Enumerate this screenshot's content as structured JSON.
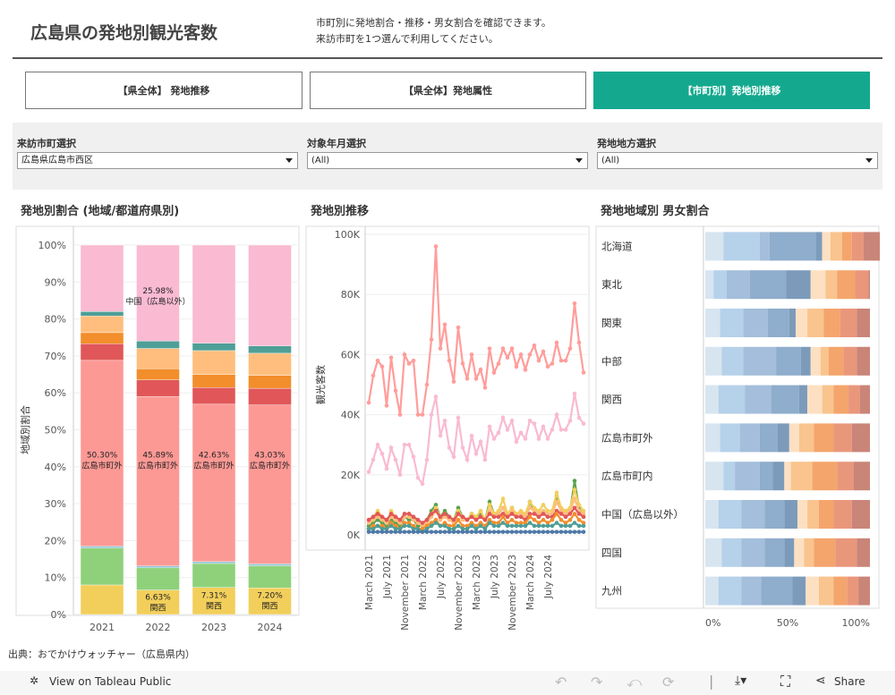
{
  "header": {
    "title": "広島県の発地別観光客数",
    "desc_line1": "市町別に発地割合・推移・男女割合を確認できます。",
    "desc_line2": "来訪市町を1つ選んで利用してください。"
  },
  "tabs": [
    {
      "label": "【県全体】 発地推移"
    },
    {
      "label": "【県全体】発地属性"
    },
    {
      "label": "【市町別】発地別推移"
    }
  ],
  "filters": {
    "city": {
      "label": "来訪市町選択",
      "value": "広島県広島市西区"
    },
    "month": {
      "label": "対象年月選択",
      "value": "(All)"
    },
    "region": {
      "label": "発地地方選択",
      "value": "(All)"
    }
  },
  "sections": {
    "share": "発地別割合 (地域/都道府県別)",
    "trend": "発地別推移",
    "gender": "発地地域別 男女割合"
  },
  "colors": {
    "accent": "#14a98f"
  },
  "chart_data": [
    {
      "type": "bar",
      "stacked": true,
      "normalized": true,
      "ylabel": "地域別割合",
      "categories": [
        "2021",
        "2022",
        "2023",
        "2024"
      ],
      "yticks": [
        "0%",
        "10%",
        "20%",
        "30%",
        "40%",
        "50%",
        "60%",
        "70%",
        "80%",
        "90%",
        "100%"
      ],
      "segment_colors": [
        "#f2cf5b",
        "#8fd17a",
        "#8cc3d4",
        "#fd9995",
        "#e15759",
        "#f28e2b",
        "#ffbe7d",
        "#4e9f97",
        "#f9bad2"
      ],
      "series_values": [
        [
          0.08,
          0.1,
          0.005,
          0.503,
          0.045,
          0.03,
          0.045,
          0.012,
          0.18
        ],
        [
          0.0663,
          0.06,
          0.005,
          0.4589,
          0.045,
          0.03,
          0.055,
          0.02,
          0.2598
        ],
        [
          0.0731,
          0.065,
          0.005,
          0.4263,
          0.045,
          0.035,
          0.065,
          0.02,
          0.2656
        ],
        [
          0.072,
          0.06,
          0.005,
          0.4303,
          0.045,
          0.035,
          0.06,
          0.02,
          0.2727
        ]
      ],
      "labels": [
        {
          "bar": 0,
          "text": "50.30%",
          "sub": "広島市町外",
          "at": 0.42
        },
        {
          "bar": 1,
          "text": "45.89%",
          "sub": "広島市町外",
          "at": 0.42
        },
        {
          "bar": 2,
          "text": "42.63%",
          "sub": "広島市町外",
          "at": 0.42
        },
        {
          "bar": 3,
          "text": "43.03%",
          "sub": "広島市町外",
          "at": 0.42
        },
        {
          "bar": 1,
          "text": "25.98%",
          "sub": "中国（広島以外）",
          "at": 0.865
        },
        {
          "bar": 1,
          "text": "6.63%",
          "sub": "関西",
          "at": 0.035
        },
        {
          "bar": 2,
          "text": "7.31%",
          "sub": "関西",
          "at": 0.04
        },
        {
          "bar": 3,
          "text": "7.20%",
          "sub": "関西",
          "at": 0.04
        }
      ]
    },
    {
      "type": "line",
      "ylabel": "観光客数",
      "ylim": [
        0,
        100000
      ],
      "yticks": [
        "0K",
        "20K",
        "40K",
        "60K",
        "80K",
        "100K"
      ],
      "xticks": [
        "March 2021",
        "July 2021",
        "November 2021",
        "March 2022",
        "July 2022",
        "November 2022",
        "March 2023",
        "July 2023",
        "November 2023",
        "March 2024",
        "July 2024"
      ],
      "series": [
        {
          "color": "#ff9d9a",
          "values": [
            44000,
            53000,
            58000,
            56000,
            43000,
            59000,
            48000,
            40000,
            60000,
            57000,
            58000,
            40000,
            40000,
            50000,
            65000,
            96000,
            62000,
            70000,
            58000,
            51000,
            69000,
            57000,
            52000,
            60000,
            52000,
            55000,
            49000,
            62000,
            54000,
            57000,
            62000,
            59000,
            62000,
            56000,
            60000,
            55000,
            60000,
            63000,
            58000,
            61000,
            56000,
            57000,
            64000,
            58000,
            58000,
            62000,
            77000,
            64000,
            54000
          ]
        },
        {
          "color": "#f9bad2",
          "values": [
            21000,
            25000,
            30000,
            27000,
            22000,
            29000,
            25000,
            20000,
            30000,
            30000,
            26000,
            19000,
            17000,
            25000,
            40000,
            46000,
            33000,
            38000,
            29000,
            26000,
            39000,
            29000,
            25000,
            33000,
            27000,
            31000,
            25000,
            36000,
            32000,
            34000,
            39000,
            35000,
            38000,
            31000,
            34000,
            32000,
            38000,
            37000,
            32000,
            36000,
            32000,
            35000,
            40000,
            35000,
            35000,
            38000,
            47000,
            39000,
            37000
          ]
        },
        {
          "color": "#59a14f",
          "values": [
            3000,
            4000,
            5000,
            4000,
            3000,
            5000,
            4000,
            3000,
            6000,
            5000,
            5000,
            3000,
            3000,
            5000,
            8000,
            10000,
            6000,
            8000,
            6000,
            5000,
            9000,
            6000,
            5000,
            7000,
            6000,
            7000,
            5000,
            11000,
            7000,
            7000,
            9000,
            6000,
            9000,
            6000,
            7000,
            6000,
            11000,
            8000,
            6000,
            8000,
            7000,
            7000,
            13000,
            8000,
            7000,
            8000,
            18000,
            9000,
            6000
          ]
        },
        {
          "color": "#f2cf5b",
          "values": [
            5000,
            6000,
            8000,
            6000,
            4000,
            8000,
            6000,
            4000,
            7000,
            7000,
            6000,
            4000,
            3000,
            5000,
            7000,
            9000,
            6000,
            7000,
            6000,
            5000,
            8000,
            6000,
            5000,
            7000,
            6000,
            8000,
            5000,
            10000,
            7000,
            8000,
            12000,
            7000,
            9000,
            7000,
            8000,
            7000,
            11000,
            9000,
            8000,
            10000,
            8000,
            8000,
            14000,
            9000,
            8000,
            9000,
            15000,
            10000,
            8000
          ]
        },
        {
          "color": "#ffbe7d",
          "values": [
            4000,
            5000,
            6000,
            5000,
            4000,
            6000,
            5000,
            4000,
            6000,
            6000,
            5000,
            4000,
            3000,
            4000,
            6000,
            8000,
            5000,
            6000,
            5000,
            4000,
            7000,
            5000,
            5000,
            6000,
            5000,
            6000,
            5000,
            8000,
            6000,
            7000,
            9000,
            6000,
            8000,
            6000,
            7000,
            6000,
            9000,
            8000,
            7000,
            8000,
            7000,
            7000,
            11000,
            8000,
            7000,
            8000,
            12000,
            8000,
            7000
          ]
        },
        {
          "color": "#e15759",
          "values": [
            5000,
            6000,
            7000,
            6000,
            5000,
            7000,
            6000,
            5000,
            7000,
            7000,
            6000,
            5000,
            4000,
            5000,
            7000,
            8000,
            6000,
            7000,
            6000,
            5000,
            7000,
            6000,
            5000,
            6000,
            5000,
            6000,
            5000,
            7000,
            6000,
            6000,
            7000,
            6000,
            7000,
            6000,
            6000,
            5000,
            7000,
            7000,
            6000,
            7000,
            6000,
            6000,
            8000,
            7000,
            6000,
            7000,
            9000,
            7000,
            6000
          ]
        },
        {
          "color": "#f28e2b",
          "values": [
            2000,
            3000,
            3000,
            3000,
            2000,
            4000,
            3000,
            2000,
            4000,
            4000,
            3000,
            2000,
            2000,
            3000,
            4000,
            5000,
            3000,
            4000,
            3000,
            3000,
            5000,
            3000,
            3000,
            4000,
            3000,
            4000,
            3000,
            5000,
            4000,
            4000,
            6000,
            4000,
            5000,
            4000,
            4000,
            4000,
            6000,
            5000,
            4000,
            5000,
            4000,
            5000,
            7000,
            5000,
            4000,
            5000,
            7000,
            5000,
            4000
          ]
        },
        {
          "color": "#4e9f97",
          "values": [
            2000,
            2000,
            3000,
            2000,
            2000,
            3000,
            2000,
            2000,
            3000,
            3000,
            2000,
            2000,
            1000,
            2000,
            3000,
            4000,
            3000,
            3000,
            2000,
            2000,
            3000,
            2000,
            2000,
            3000,
            2000,
            3000,
            2000,
            4000,
            3000,
            3000,
            4000,
            3000,
            3000,
            3000,
            3000,
            3000,
            4000,
            3000,
            3000,
            3000,
            3000,
            3000,
            4000,
            3000,
            3000,
            3000,
            4000,
            3000,
            3000
          ]
        },
        {
          "color": "#4e79a7",
          "values": [
            1000,
            1000,
            1000,
            1000,
            1000,
            1000,
            1000,
            1000,
            1000,
            1000,
            1000,
            1000,
            1000,
            1000,
            1000,
            1000,
            1000,
            1000,
            1000,
            1000,
            1000,
            1000,
            1000,
            1000,
            1000,
            1000,
            1000,
            1000,
            1000,
            1000,
            1000,
            1000,
            1000,
            1000,
            1000,
            1000,
            1000,
            1000,
            1000,
            1000,
            1000,
            1000,
            1000,
            1000,
            1000,
            1000,
            1000,
            1000,
            1000
          ]
        }
      ]
    },
    {
      "type": "bar",
      "horizontal": true,
      "stacked": true,
      "normalized": true,
      "categories": [
        "北海道",
        "東北",
        "関東",
        "中部",
        "関西",
        "広島市町外",
        "広島市町内",
        "中国（広島以外）",
        "四国",
        "九州"
      ],
      "xticks": [
        "0%",
        "50%",
        "100%"
      ],
      "segment_colors": [
        "#d7e5f1",
        "#b6d1ea",
        "#a4bedb",
        "#8fadcc",
        "#7c9bbb",
        "#fde0c2",
        "#f9c48e",
        "#f4a56c",
        "#e9977b",
        "#c98578"
      ],
      "values": [
        [
          0.11,
          0.22,
          0.06,
          0.28,
          0.04,
          0.05,
          0.07,
          0.06,
          0.07,
          0.1
        ],
        [
          0.05,
          0.08,
          0.14,
          0.22,
          0.15,
          0.09,
          0.07,
          0.11,
          0.08,
          0.01
        ],
        [
          0.09,
          0.14,
          0.15,
          0.13,
          0.04,
          0.07,
          0.1,
          0.1,
          0.1,
          0.08
        ],
        [
          0.1,
          0.13,
          0.2,
          0.15,
          0.06,
          0.06,
          0.05,
          0.09,
          0.08,
          0.08
        ],
        [
          0.08,
          0.16,
          0.16,
          0.17,
          0.05,
          0.09,
          0.07,
          0.09,
          0.07,
          0.06
        ],
        [
          0.09,
          0.12,
          0.12,
          0.11,
          0.07,
          0.06,
          0.09,
          0.12,
          0.11,
          0.11
        ],
        [
          0.11,
          0.07,
          0.15,
          0.08,
          0.07,
          0.04,
          0.13,
          0.15,
          0.1,
          0.1
        ],
        [
          0.08,
          0.14,
          0.14,
          0.12,
          0.08,
          0.06,
          0.07,
          0.09,
          0.11,
          0.11
        ],
        [
          0.1,
          0.12,
          0.14,
          0.12,
          0.06,
          0.06,
          0.06,
          0.13,
          0.13,
          0.08
        ],
        [
          0.08,
          0.14,
          0.12,
          0.19,
          0.08,
          0.08,
          0.09,
          0.08,
          0.07,
          0.07
        ]
      ]
    }
  ],
  "footer": {
    "source": "出典：おでかけウォッチャー（広島県内）",
    "view_label": "View on Tableau Public",
    "share_label": "Share"
  }
}
